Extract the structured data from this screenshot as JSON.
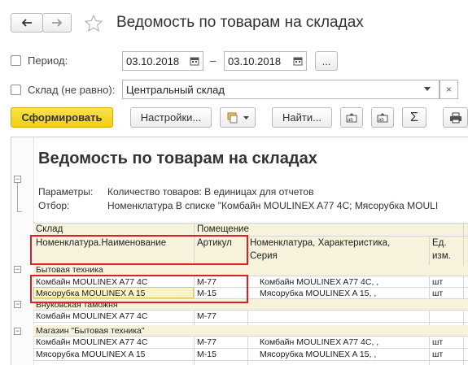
{
  "window": {
    "title": "Ведомость по товарам на складах"
  },
  "toolbar": {
    "back_icon": "arrow-left-icon",
    "forward_icon": "arrow-right-icon",
    "star_icon": "star-icon"
  },
  "filters": {
    "period_label": "Период:",
    "date_from": "03.10.2018",
    "date_sep": "–",
    "date_to": "03.10.2018",
    "more_label": "...",
    "warehouse_label": "Склад (не равно):",
    "warehouse_value": "Центральный склад"
  },
  "actions": {
    "generate": "Сформировать",
    "settings": "Настройки...",
    "find": "Найти...",
    "sum_symbol": "Σ"
  },
  "colors": {
    "generate_bg": "#f5d51c",
    "header_bg": "#f6f2dc",
    "highlight": "#e01e1e"
  },
  "report": {
    "title": "Ведомость по товарам на складах",
    "params_label": "Параметры:",
    "params_value": "Количество товаров: В единицах для отчетов",
    "filter_label": "Отбор:",
    "filter_value": "Номенклатура В списке \"Комбайн MOULINEX  A77 4C; Мясорубка MOULI",
    "headers": {
      "warehouse": "Склад",
      "room": "Помещение",
      "name": "Номенклатура.Наименование",
      "article": "Артикул",
      "characteristics": "Номенклатура, Характеристика,",
      "series": "Серия",
      "unit1": "Ед.",
      "unit2": "изм."
    },
    "groups": [
      {
        "name": "Бытовая техника",
        "rows": [
          {
            "name": "Комбайн MOULINEX  A77 4C",
            "article": "М-77",
            "char": "Комбайн MOULINEX  A77 4C, ,",
            "unit": "шт"
          },
          {
            "name": "Мясорубка MOULINEX  A 15",
            "article": "М-15",
            "char": "Мясорубка MOULINEX  A 15, ,",
            "unit": "шт"
          }
        ]
      },
      {
        "name": "Внуковская таможня",
        "rows": [
          {
            "name": "Комбайн MOULINEX  A77 4C",
            "article": "М-77",
            "char": "",
            "unit": ""
          }
        ]
      },
      {
        "name": "Магазин \"Бытовая техника\"",
        "rows": [
          {
            "name": "Комбайн MOULINEX  A77 4C",
            "article": "М-77",
            "char": "Комбайн MOULINEX  A77 4C, ,",
            "unit": "шт"
          },
          {
            "name": "Мясорубка MOULINEX  A 15",
            "article": "М-15",
            "char": "Мясорубка MOULINEX  A 15, ,",
            "unit": "шт"
          }
        ]
      }
    ]
  }
}
